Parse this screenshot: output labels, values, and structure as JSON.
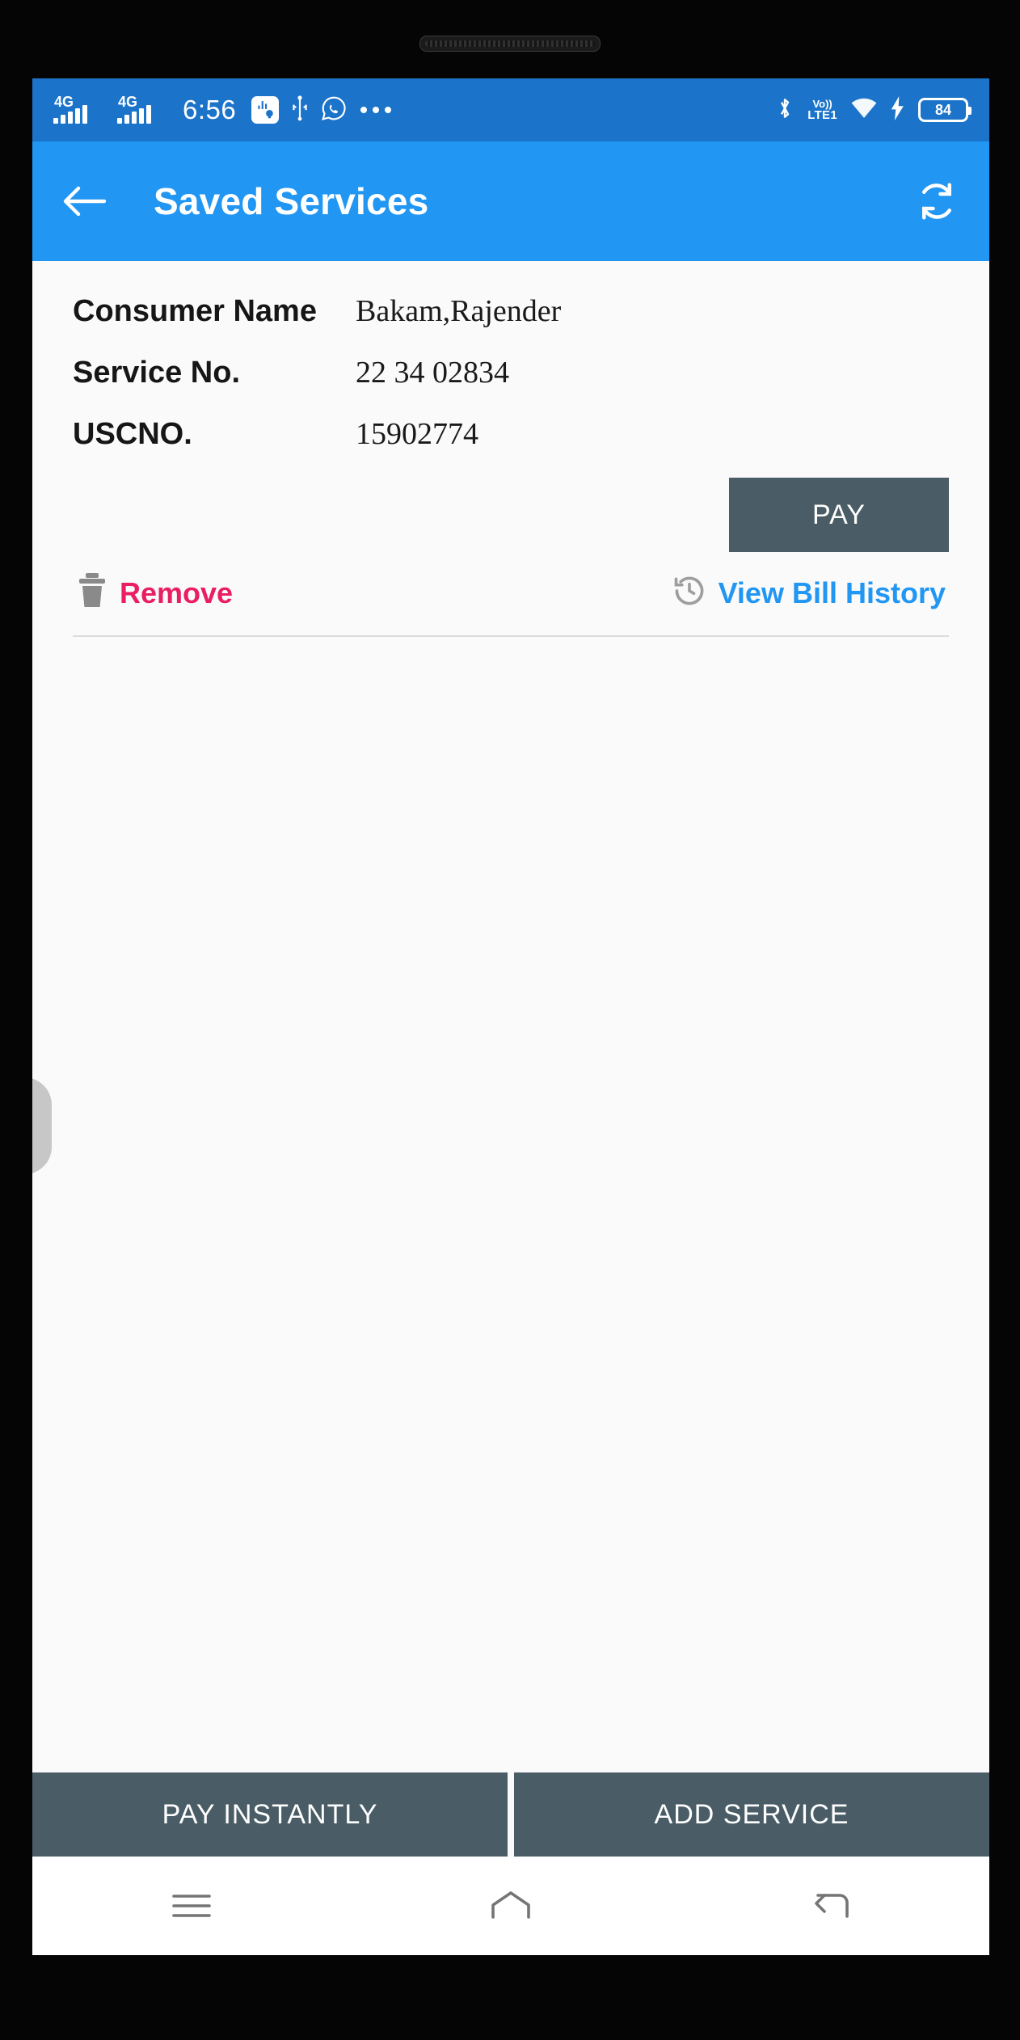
{
  "status_bar": {
    "network_1": "4G",
    "network_2": "4G",
    "time": "6:56",
    "usb_debug_icon": "usb-debug-icon",
    "usb_icon": "usb-icon",
    "whatsapp_icon": "whatsapp-icon",
    "overflow_icon": "more-notifications-icon",
    "bluetooth_icon": "bluetooth-icon",
    "volte_top": "Vo))",
    "volte_bottom": "LTE1",
    "wifi_icon": "wifi-icon",
    "charging_icon": "charging-bolt-icon",
    "battery_level": "84",
    "background": "#1b74ca"
  },
  "app_bar": {
    "back_icon": "back-arrow-icon",
    "title": "Saved Services",
    "refresh_icon": "refresh-icon",
    "background": "#2196f3"
  },
  "service_card": {
    "fields": [
      {
        "label": "Consumer Name",
        "value": "Bakam,Rajender"
      },
      {
        "label": "Service No.",
        "value": "22 34 02834"
      },
      {
        "label": "USCNO.",
        "value": "15902774"
      }
    ],
    "pay_button": "PAY",
    "remove_label": "Remove",
    "remove_icon": "trash-icon",
    "remove_color": "#e91e63",
    "history_label": "View Bill History",
    "history_icon": "history-clock-icon",
    "history_color": "#2196f3",
    "button_color": "#4a5c66"
  },
  "bottom_bar": {
    "pay_instantly": "PAY INSTANTLY",
    "add_service": "ADD SERVICE"
  },
  "nav_bar": {
    "menu_icon": "menu-icon",
    "home_icon": "home-icon",
    "back_icon": "back-nav-icon"
  }
}
